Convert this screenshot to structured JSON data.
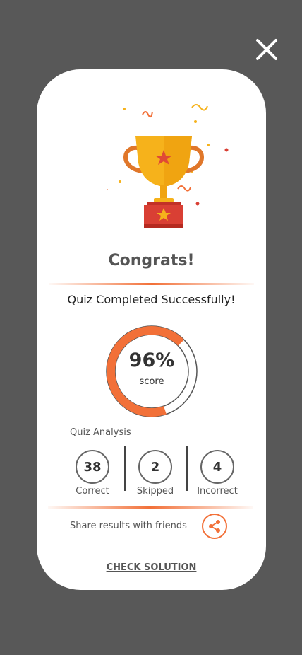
{
  "header": {
    "close_icon": "close-icon"
  },
  "result": {
    "title": "Congrats!",
    "subtitle": "Quiz Completed Successfully!",
    "score_percent": 96,
    "score_text": "96%",
    "score_label": "score"
  },
  "analysis": {
    "heading": "Quiz Analysis",
    "stats": [
      {
        "value": "38",
        "label": "Correct"
      },
      {
        "value": "2",
        "label": "Skipped"
      },
      {
        "value": "4",
        "label": "Incorrect"
      }
    ]
  },
  "share": {
    "label": "Share results with friends",
    "icon": "share-icon"
  },
  "actions": {
    "check_solution": "CHECK SOLUTION"
  },
  "colors": {
    "accent": "#f27038",
    "background": "#585858",
    "trophy_gold": "#f6b21b",
    "trophy_base": "#d93f34"
  }
}
